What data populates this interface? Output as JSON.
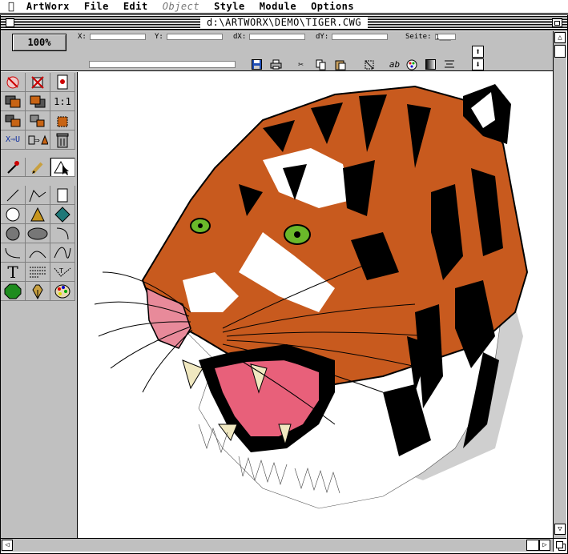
{
  "menubar": {
    "apple_icon": "",
    "items": [
      {
        "label": "ArtWorx",
        "enabled": true
      },
      {
        "label": "File",
        "enabled": true
      },
      {
        "label": "Edit",
        "enabled": true
      },
      {
        "label": "Object",
        "enabled": false
      },
      {
        "label": "Style",
        "enabled": true
      },
      {
        "label": "Module",
        "enabled": true
      },
      {
        "label": "Options",
        "enabled": true
      }
    ]
  },
  "window": {
    "title": "d:\\ARTWORX\\DEMO\\TIGER.CWG"
  },
  "infobar": {
    "zoom": "100%",
    "x_label": "X:",
    "y_label": "Y:",
    "dx_label": "dX:",
    "dy_label": "dY:",
    "page_label": "Seite:",
    "page_value": "1___"
  },
  "toolbar_icons": [
    "save-icon",
    "print-icon",
    "cut-icon",
    "copy-icon",
    "paste-icon",
    "crop-icon",
    "text-style-icon",
    "palette-icon",
    "gradient-icon",
    "align-icon"
  ],
  "toolbox": {
    "rows": [
      [
        "no-brush-icon",
        "no-pen-icon",
        "page-icon"
      ],
      [
        "bring-front-icon",
        "send-back-icon",
        "1:1"
      ],
      [
        "group-icon",
        "ungroup-icon",
        "resize-icon"
      ],
      [
        "X⇒U",
        "triangle-to-icon",
        "trash-icon"
      ],
      [
        "eyedropper-icon",
        "pencil-icon",
        "select-arrow-icon"
      ],
      [
        "line-icon",
        "polyline-icon",
        "rectangle-icon"
      ],
      [
        "circle-icon",
        "triangle-icon",
        "diamond-icon"
      ],
      [
        "ellipse-icon",
        "oval-icon",
        "arc-icon"
      ],
      [
        "curve-icon",
        "bezier-icon",
        "wave-icon"
      ],
      [
        "T",
        "paragraph-icon",
        "path-text-icon"
      ],
      [
        "octagon-icon",
        "nib-icon",
        "paint-palette-icon"
      ]
    ],
    "selected": "select-arrow-icon"
  },
  "colors": {
    "tiger_orange": "#c85a1e",
    "tiger_dark_orange": "#a0400f",
    "eye_green": "#6ab82a",
    "mouth_pink": "#e8607a",
    "nose_pink": "#e88a9a",
    "ui_gray": "#c0c0c0"
  }
}
